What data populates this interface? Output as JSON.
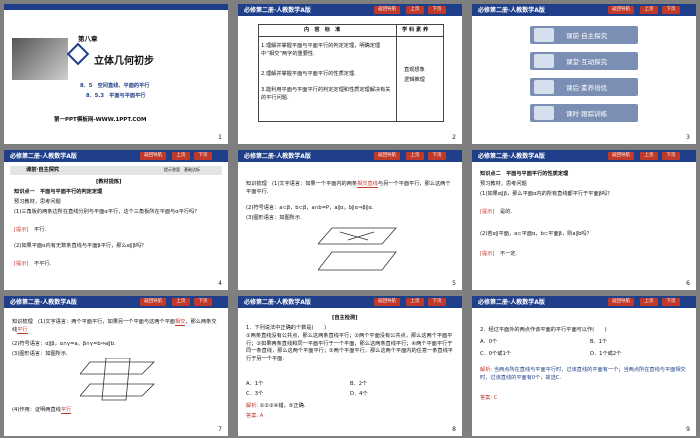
{
  "header_title": "必修第二册·人教数学A版",
  "nav": {
    "back": "返回导航",
    "prev": "上页",
    "next": "下页"
  },
  "slide1": {
    "chapter": "第八章",
    "book_title": "立体几何初步",
    "section_a": "8．5　空间直线、平面的平行",
    "section_b": "8．5.3　平面与平面平行",
    "footer": "第一PPT模板网-WWW.1PPT.COM",
    "page": "1"
  },
  "slide2": {
    "col_content": "内　容　标　准",
    "col_literacy": "学 科 素 养",
    "item1": "1.理解并掌握平面与平面平行的判定定理，明确定理中“相交”两字的重要性.",
    "item2": "2.理解并掌握平面与平面平行的性质定理.",
    "item3": "3.能利用平面与平面平行的判定定理和性质定理解决有关的平行问题.",
    "literacy1": "直观想象",
    "literacy2": "逻辑推理",
    "page": "2"
  },
  "slide3": {
    "menu": [
      "课前·自主探究",
      "课堂·互动探究",
      "课后·素养培优",
      "课时·跟踪训练"
    ],
    "page": "3"
  },
  "slide4": {
    "bar": "课前·自主探究",
    "bar_right": "提示答案　基础达标",
    "block": "[教材提炼]",
    "point": "知识点一　平面与平面平行的判定定理",
    "pre": "预习教材，思考问题",
    "q1": "(1)三角板的两条边所在直线分别与平面α平行，这个三角板所在平面与α平行吗？",
    "hint": "[提示]",
    "a1": "平行.",
    "q2": "(2)如果平面α内有无数条直线与平面β平行，那么α∥β吗？",
    "a2": "不平行.",
    "page": "4"
  },
  "slide5": {
    "text1": "知识梳理　(1)文字语言：如果一个平面内的两条",
    "blank": "相交直线",
    "text2": "与另一个平面平行，那么这两个平面平行.",
    "text3": "(2)符号语言：a⊂β，b⊂β，a∩b=P，a∥α，b∥α⇒β∥α.",
    "text4": "(3)图形语言：如图所示.",
    "page": "5"
  },
  "slide6": {
    "point": "知识点二　平面与平面平行的性质定理",
    "pre": "预习教材，思考问题",
    "q1": "(1)如果α∥β，那么平面α内的所有直线都平行于平面β吗？",
    "a1": "是的.",
    "q2": "(2)若α∥平面，a⊂平面α，b⊂平面β，则a∥b吗？",
    "a2": "不一定.",
    "hint": "[提示]",
    "page": "6"
  },
  "slide7": {
    "text1": "知识梳理　(1)文字语言：两个平面平行，如果另一个平面与这两个平面",
    "blank": "相交",
    "text1b": "，那么两条交线",
    "blank2": "平行",
    "text2": "(2)符号语言：α∥β，α∩γ=a，β∩γ=b⇒a∥b.",
    "text3": "(3)图形语言：如图所示.",
    "text4": "(4)作用：证明两直线",
    "blank3": "平行",
    "page": "7"
  },
  "slide8": {
    "block": "[自主检测]",
    "q": "1．下列说法中正确的个数是(　　)",
    "s1": "①两条直线没有公共点，那么这两条直线平行；②两个平面没有公共点，那么这两个平面平行；③如果两条直线和同一平面平行于一个平面，那么这两条直线平行；④两个平面平行于同一条直线，那么这两个平面平行；⑤两个平面平行，那么这两个平面内的任意一条直线平行于另一个平面.",
    "opts": [
      "A．1个",
      "B．2个",
      "C．3个",
      "D．4个"
    ],
    "sol_label": "解析:",
    "sol": "①②③④错，⑤正确.",
    "ans_label": "答案:",
    "ans": "A",
    "page": "8"
  },
  "slide9": {
    "q": "2．经过平面外的两点作该平面的平行平面可以作(　　)",
    "opts": [
      "A．0个",
      "B．1个",
      "C．0个或1个",
      "D．1个或2个"
    ],
    "sol_label": "解析:",
    "sol": "当两点所在直线与平面平行时，过该直线的平面有一个；当两点所在直线与平面相交时，过该直线的平面有0个，故选C.",
    "ans_label": "答案:",
    "ans": "C",
    "page": "9"
  }
}
